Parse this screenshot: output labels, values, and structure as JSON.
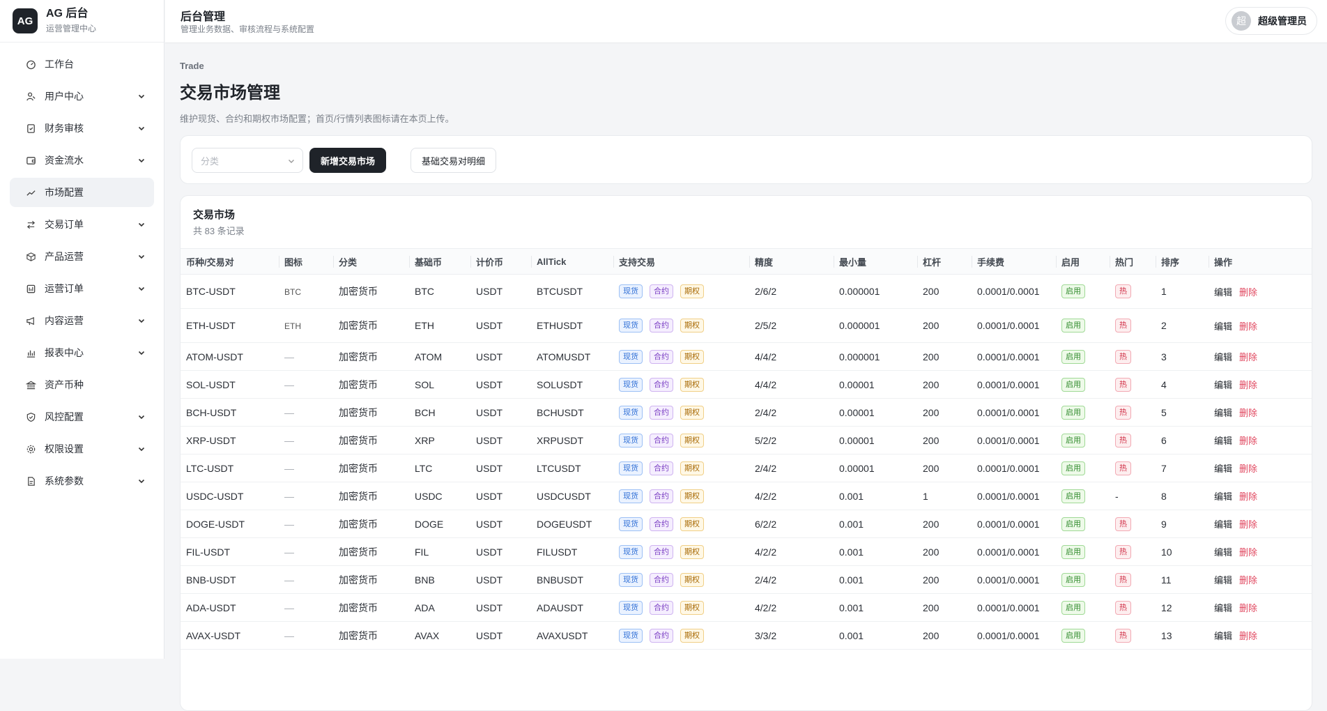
{
  "brand": {
    "logo": "AG",
    "title": "AG 后台",
    "subtitle": "运营管理中心"
  },
  "sidebar": {
    "items": [
      {
        "label": "工作台",
        "icon": "dashboard-icon",
        "expandable": false,
        "active": false
      },
      {
        "label": "用户中心",
        "icon": "user-icon",
        "expandable": true,
        "active": false
      },
      {
        "label": "财务审核",
        "icon": "audit-icon",
        "expandable": true,
        "active": false
      },
      {
        "label": "资金流水",
        "icon": "wallet-icon",
        "expandable": true,
        "active": false
      },
      {
        "label": "市场配置",
        "icon": "chart-line-icon",
        "expandable": false,
        "active": true
      },
      {
        "label": "交易订单",
        "icon": "swap-icon",
        "expandable": true,
        "active": false
      },
      {
        "label": "产品运营",
        "icon": "box-icon",
        "expandable": true,
        "active": false
      },
      {
        "label": "运营订单",
        "icon": "calendar-icon",
        "expandable": true,
        "active": false
      },
      {
        "label": "内容运营",
        "icon": "megaphone-icon",
        "expandable": true,
        "active": false
      },
      {
        "label": "报表中心",
        "icon": "bar-chart-icon",
        "expandable": true,
        "active": false
      },
      {
        "label": "资产币种",
        "icon": "bank-icon",
        "expandable": false,
        "active": false
      },
      {
        "label": "风控配置",
        "icon": "shield-icon",
        "expandable": true,
        "active": false
      },
      {
        "label": "权限设置",
        "icon": "gear-icon",
        "expandable": true,
        "active": false
      },
      {
        "label": "系统参数",
        "icon": "file-icon",
        "expandable": true,
        "active": false
      }
    ]
  },
  "header": {
    "title": "后台管理",
    "subtitle": "管理业务数据、审核流程与系统配置",
    "user_avatar": "超",
    "user_name": "超级管理员"
  },
  "page": {
    "breadcrumb": "Trade",
    "title": "交易市场管理",
    "description": "维护现货、合约和期权市场配置；首页/行情列表图标请在本页上传。"
  },
  "filters": {
    "category_placeholder": "分类",
    "add_button": "新增交易市场",
    "detail_button": "基础交易对明细"
  },
  "table": {
    "title": "交易市场",
    "count": "共 83 条记录",
    "columns": [
      "币种/交易对",
      "图标",
      "分类",
      "基础币",
      "计价币",
      "AllTick",
      "支持交易",
      "精度",
      "最小量",
      "杠杆",
      "手续费",
      "启用",
      "热门",
      "排序",
      "操作"
    ],
    "tags": {
      "spot": "现货",
      "swap": "合约",
      "option": "期权",
      "enabled": "启用",
      "hot": "热"
    },
    "actions": {
      "edit": "编辑",
      "delete": "删除"
    },
    "rows": [
      {
        "pair": "BTC-USDT",
        "icon": "BTC",
        "category": "加密货币",
        "base": "BTC",
        "quote": "USDT",
        "alltick": "BTCUSDT",
        "precision": "2/6/2",
        "min": "0.000001",
        "leverage": "200",
        "fee": "0.0001/0.0001",
        "hot": "热",
        "sort": "1"
      },
      {
        "pair": "ETH-USDT",
        "icon": "ETH",
        "category": "加密货币",
        "base": "ETH",
        "quote": "USDT",
        "alltick": "ETHUSDT",
        "precision": "2/5/2",
        "min": "0.000001",
        "leverage": "200",
        "fee": "0.0001/0.0001",
        "hot": "热",
        "sort": "2"
      },
      {
        "pair": "ATOM-USDT",
        "icon": "—",
        "category": "加密货币",
        "base": "ATOM",
        "quote": "USDT",
        "alltick": "ATOMUSDT",
        "precision": "4/4/2",
        "min": "0.000001",
        "leverage": "200",
        "fee": "0.0001/0.0001",
        "hot": "热",
        "sort": "3"
      },
      {
        "pair": "SOL-USDT",
        "icon": "—",
        "category": "加密货币",
        "base": "SOL",
        "quote": "USDT",
        "alltick": "SOLUSDT",
        "precision": "4/4/2",
        "min": "0.00001",
        "leverage": "200",
        "fee": "0.0001/0.0001",
        "hot": "热",
        "sort": "4"
      },
      {
        "pair": "BCH-USDT",
        "icon": "—",
        "category": "加密货币",
        "base": "BCH",
        "quote": "USDT",
        "alltick": "BCHUSDT",
        "precision": "2/4/2",
        "min": "0.00001",
        "leverage": "200",
        "fee": "0.0001/0.0001",
        "hot": "热",
        "sort": "5"
      },
      {
        "pair": "XRP-USDT",
        "icon": "—",
        "category": "加密货币",
        "base": "XRP",
        "quote": "USDT",
        "alltick": "XRPUSDT",
        "precision": "5/2/2",
        "min": "0.00001",
        "leverage": "200",
        "fee": "0.0001/0.0001",
        "hot": "热",
        "sort": "6"
      },
      {
        "pair": "LTC-USDT",
        "icon": "—",
        "category": "加密货币",
        "base": "LTC",
        "quote": "USDT",
        "alltick": "LTCUSDT",
        "precision": "2/4/2",
        "min": "0.00001",
        "leverage": "200",
        "fee": "0.0001/0.0001",
        "hot": "热",
        "sort": "7"
      },
      {
        "pair": "USDC-USDT",
        "icon": "—",
        "category": "加密货币",
        "base": "USDC",
        "quote": "USDT",
        "alltick": "USDCUSDT",
        "precision": "4/2/2",
        "min": "0.001",
        "leverage": "1",
        "fee": "0.0001/0.0001",
        "hot": "-",
        "sort": "8"
      },
      {
        "pair": "DOGE-USDT",
        "icon": "—",
        "category": "加密货币",
        "base": "DOGE",
        "quote": "USDT",
        "alltick": "DOGEUSDT",
        "precision": "6/2/2",
        "min": "0.001",
        "leverage": "200",
        "fee": "0.0001/0.0001",
        "hot": "热",
        "sort": "9"
      },
      {
        "pair": "FIL-USDT",
        "icon": "—",
        "category": "加密货币",
        "base": "FIL",
        "quote": "USDT",
        "alltick": "FILUSDT",
        "precision": "4/2/2",
        "min": "0.001",
        "leverage": "200",
        "fee": "0.0001/0.0001",
        "hot": "热",
        "sort": "10"
      },
      {
        "pair": "BNB-USDT",
        "icon": "—",
        "category": "加密货币",
        "base": "BNB",
        "quote": "USDT",
        "alltick": "BNBUSDT",
        "precision": "2/4/2",
        "min": "0.001",
        "leverage": "200",
        "fee": "0.0001/0.0001",
        "hot": "热",
        "sort": "11"
      },
      {
        "pair": "ADA-USDT",
        "icon": "—",
        "category": "加密货币",
        "base": "ADA",
        "quote": "USDT",
        "alltick": "ADAUSDT",
        "precision": "4/2/2",
        "min": "0.001",
        "leverage": "200",
        "fee": "0.0001/0.0001",
        "hot": "热",
        "sort": "12"
      },
      {
        "pair": "AVAX-USDT",
        "icon": "—",
        "category": "加密货币",
        "base": "AVAX",
        "quote": "USDT",
        "alltick": "AVAXUSDT",
        "precision": "3/3/2",
        "min": "0.001",
        "leverage": "200",
        "fee": "0.0001/0.0001",
        "hot": "热",
        "sort": "13"
      }
    ]
  },
  "colors": {
    "accent": "#1f2329",
    "spot": "#2f6fd6",
    "swap": "#7b3fc4",
    "option": "#a86a05",
    "enabled": "#2f8a2b",
    "hot": "#d1334a",
    "delete": "#e0465e"
  }
}
